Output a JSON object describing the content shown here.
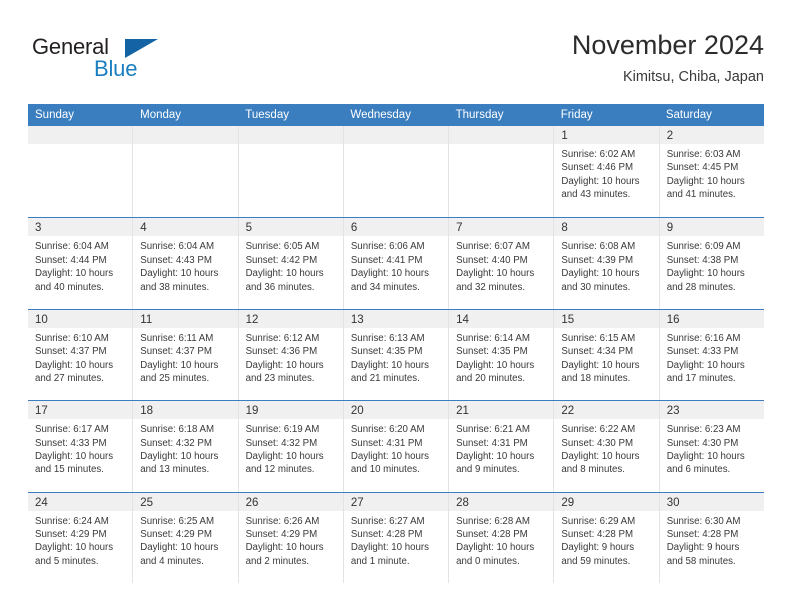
{
  "brand": {
    "word_general": "General",
    "word_blue": "Blue",
    "flag_icon": "triangle-flag-icon",
    "accent_color": "#1464a5",
    "blue_text_color": "#1a7fc1"
  },
  "header": {
    "title": "November 2024",
    "subtitle": "Kimitsu, Chiba, Japan"
  },
  "theme": {
    "header_row_bg": "#3a7ebf",
    "daynum_strip_bg": "#f0f0f0",
    "cell_border": "#e3e3e3",
    "text_color": "#3a3a3a"
  },
  "weekdays": [
    "Sunday",
    "Monday",
    "Tuesday",
    "Wednesday",
    "Thursday",
    "Friday",
    "Saturday"
  ],
  "weeks": [
    [
      {
        "day": "",
        "empty": true,
        "sunrise": "",
        "sunset": "",
        "daylight_line1": "",
        "daylight_line2": ""
      },
      {
        "day": "",
        "empty": true,
        "sunrise": "",
        "sunset": "",
        "daylight_line1": "",
        "daylight_line2": ""
      },
      {
        "day": "",
        "empty": true,
        "sunrise": "",
        "sunset": "",
        "daylight_line1": "",
        "daylight_line2": ""
      },
      {
        "day": "",
        "empty": true,
        "sunrise": "",
        "sunset": "",
        "daylight_line1": "",
        "daylight_line2": ""
      },
      {
        "day": "",
        "empty": true,
        "sunrise": "",
        "sunset": "",
        "daylight_line1": "",
        "daylight_line2": ""
      },
      {
        "day": "1",
        "empty": false,
        "sunrise": "Sunrise: 6:02 AM",
        "sunset": "Sunset: 4:46 PM",
        "daylight_line1": "Daylight: 10 hours",
        "daylight_line2": "and 43 minutes."
      },
      {
        "day": "2",
        "empty": false,
        "sunrise": "Sunrise: 6:03 AM",
        "sunset": "Sunset: 4:45 PM",
        "daylight_line1": "Daylight: 10 hours",
        "daylight_line2": "and 41 minutes."
      }
    ],
    [
      {
        "day": "3",
        "empty": false,
        "sunrise": "Sunrise: 6:04 AM",
        "sunset": "Sunset: 4:44 PM",
        "daylight_line1": "Daylight: 10 hours",
        "daylight_line2": "and 40 minutes."
      },
      {
        "day": "4",
        "empty": false,
        "sunrise": "Sunrise: 6:04 AM",
        "sunset": "Sunset: 4:43 PM",
        "daylight_line1": "Daylight: 10 hours",
        "daylight_line2": "and 38 minutes."
      },
      {
        "day": "5",
        "empty": false,
        "sunrise": "Sunrise: 6:05 AM",
        "sunset": "Sunset: 4:42 PM",
        "daylight_line1": "Daylight: 10 hours",
        "daylight_line2": "and 36 minutes."
      },
      {
        "day": "6",
        "empty": false,
        "sunrise": "Sunrise: 6:06 AM",
        "sunset": "Sunset: 4:41 PM",
        "daylight_line1": "Daylight: 10 hours",
        "daylight_line2": "and 34 minutes."
      },
      {
        "day": "7",
        "empty": false,
        "sunrise": "Sunrise: 6:07 AM",
        "sunset": "Sunset: 4:40 PM",
        "daylight_line1": "Daylight: 10 hours",
        "daylight_line2": "and 32 minutes."
      },
      {
        "day": "8",
        "empty": false,
        "sunrise": "Sunrise: 6:08 AM",
        "sunset": "Sunset: 4:39 PM",
        "daylight_line1": "Daylight: 10 hours",
        "daylight_line2": "and 30 minutes."
      },
      {
        "day": "9",
        "empty": false,
        "sunrise": "Sunrise: 6:09 AM",
        "sunset": "Sunset: 4:38 PM",
        "daylight_line1": "Daylight: 10 hours",
        "daylight_line2": "and 28 minutes."
      }
    ],
    [
      {
        "day": "10",
        "empty": false,
        "sunrise": "Sunrise: 6:10 AM",
        "sunset": "Sunset: 4:37 PM",
        "daylight_line1": "Daylight: 10 hours",
        "daylight_line2": "and 27 minutes."
      },
      {
        "day": "11",
        "empty": false,
        "sunrise": "Sunrise: 6:11 AM",
        "sunset": "Sunset: 4:37 PM",
        "daylight_line1": "Daylight: 10 hours",
        "daylight_line2": "and 25 minutes."
      },
      {
        "day": "12",
        "empty": false,
        "sunrise": "Sunrise: 6:12 AM",
        "sunset": "Sunset: 4:36 PM",
        "daylight_line1": "Daylight: 10 hours",
        "daylight_line2": "and 23 minutes."
      },
      {
        "day": "13",
        "empty": false,
        "sunrise": "Sunrise: 6:13 AM",
        "sunset": "Sunset: 4:35 PM",
        "daylight_line1": "Daylight: 10 hours",
        "daylight_line2": "and 21 minutes."
      },
      {
        "day": "14",
        "empty": false,
        "sunrise": "Sunrise: 6:14 AM",
        "sunset": "Sunset: 4:35 PM",
        "daylight_line1": "Daylight: 10 hours",
        "daylight_line2": "and 20 minutes."
      },
      {
        "day": "15",
        "empty": false,
        "sunrise": "Sunrise: 6:15 AM",
        "sunset": "Sunset: 4:34 PM",
        "daylight_line1": "Daylight: 10 hours",
        "daylight_line2": "and 18 minutes."
      },
      {
        "day": "16",
        "empty": false,
        "sunrise": "Sunrise: 6:16 AM",
        "sunset": "Sunset: 4:33 PM",
        "daylight_line1": "Daylight: 10 hours",
        "daylight_line2": "and 17 minutes."
      }
    ],
    [
      {
        "day": "17",
        "empty": false,
        "sunrise": "Sunrise: 6:17 AM",
        "sunset": "Sunset: 4:33 PM",
        "daylight_line1": "Daylight: 10 hours",
        "daylight_line2": "and 15 minutes."
      },
      {
        "day": "18",
        "empty": false,
        "sunrise": "Sunrise: 6:18 AM",
        "sunset": "Sunset: 4:32 PM",
        "daylight_line1": "Daylight: 10 hours",
        "daylight_line2": "and 13 minutes."
      },
      {
        "day": "19",
        "empty": false,
        "sunrise": "Sunrise: 6:19 AM",
        "sunset": "Sunset: 4:32 PM",
        "daylight_line1": "Daylight: 10 hours",
        "daylight_line2": "and 12 minutes."
      },
      {
        "day": "20",
        "empty": false,
        "sunrise": "Sunrise: 6:20 AM",
        "sunset": "Sunset: 4:31 PM",
        "daylight_line1": "Daylight: 10 hours",
        "daylight_line2": "and 10 minutes."
      },
      {
        "day": "21",
        "empty": false,
        "sunrise": "Sunrise: 6:21 AM",
        "sunset": "Sunset: 4:31 PM",
        "daylight_line1": "Daylight: 10 hours",
        "daylight_line2": "and 9 minutes."
      },
      {
        "day": "22",
        "empty": false,
        "sunrise": "Sunrise: 6:22 AM",
        "sunset": "Sunset: 4:30 PM",
        "daylight_line1": "Daylight: 10 hours",
        "daylight_line2": "and 8 minutes."
      },
      {
        "day": "23",
        "empty": false,
        "sunrise": "Sunrise: 6:23 AM",
        "sunset": "Sunset: 4:30 PM",
        "daylight_line1": "Daylight: 10 hours",
        "daylight_line2": "and 6 minutes."
      }
    ],
    [
      {
        "day": "24",
        "empty": false,
        "sunrise": "Sunrise: 6:24 AM",
        "sunset": "Sunset: 4:29 PM",
        "daylight_line1": "Daylight: 10 hours",
        "daylight_line2": "and 5 minutes."
      },
      {
        "day": "25",
        "empty": false,
        "sunrise": "Sunrise: 6:25 AM",
        "sunset": "Sunset: 4:29 PM",
        "daylight_line1": "Daylight: 10 hours",
        "daylight_line2": "and 4 minutes."
      },
      {
        "day": "26",
        "empty": false,
        "sunrise": "Sunrise: 6:26 AM",
        "sunset": "Sunset: 4:29 PM",
        "daylight_line1": "Daylight: 10 hours",
        "daylight_line2": "and 2 minutes."
      },
      {
        "day": "27",
        "empty": false,
        "sunrise": "Sunrise: 6:27 AM",
        "sunset": "Sunset: 4:28 PM",
        "daylight_line1": "Daylight: 10 hours",
        "daylight_line2": "and 1 minute."
      },
      {
        "day": "28",
        "empty": false,
        "sunrise": "Sunrise: 6:28 AM",
        "sunset": "Sunset: 4:28 PM",
        "daylight_line1": "Daylight: 10 hours",
        "daylight_line2": "and 0 minutes."
      },
      {
        "day": "29",
        "empty": false,
        "sunrise": "Sunrise: 6:29 AM",
        "sunset": "Sunset: 4:28 PM",
        "daylight_line1": "Daylight: 9 hours",
        "daylight_line2": "and 59 minutes."
      },
      {
        "day": "30",
        "empty": false,
        "sunrise": "Sunrise: 6:30 AM",
        "sunset": "Sunset: 4:28 PM",
        "daylight_line1": "Daylight: 9 hours",
        "daylight_line2": "and 58 minutes."
      }
    ]
  ]
}
